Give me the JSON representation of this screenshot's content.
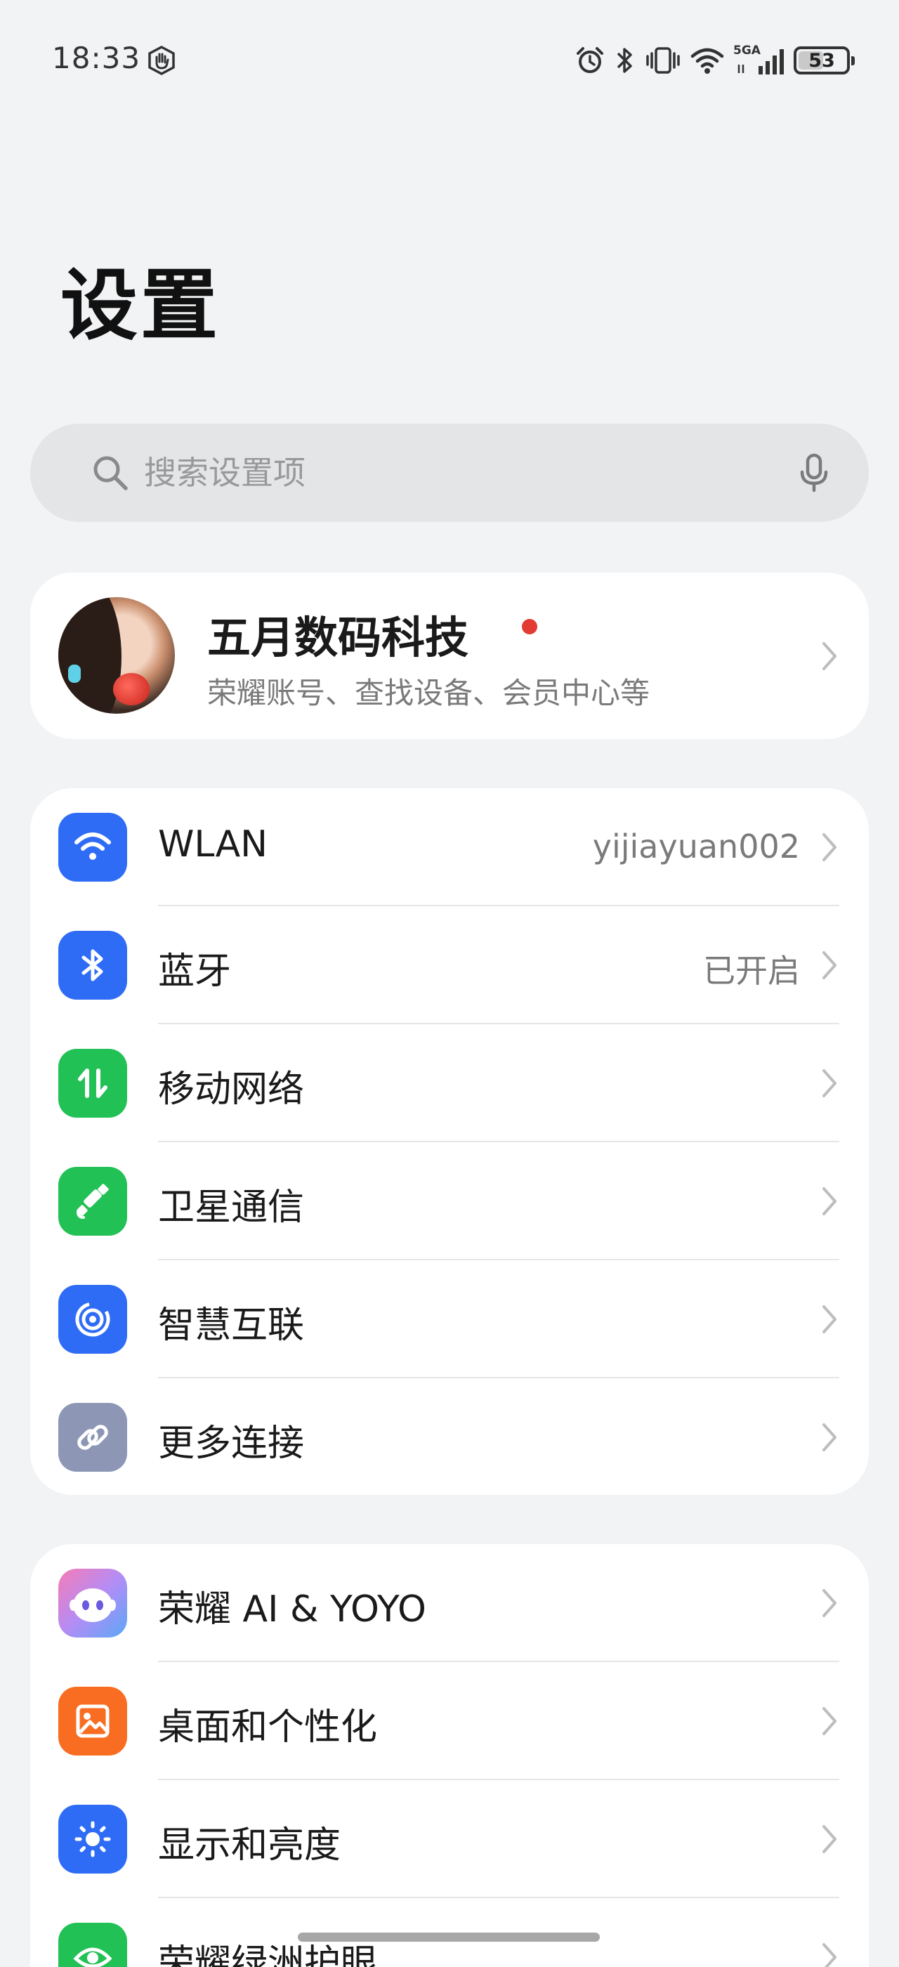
{
  "status_bar": {
    "time": "18:33",
    "icons": [
      "gesture-hand-icon",
      "alarm-icon",
      "bluetooth-icon",
      "vibrate-icon",
      "wifi-icon",
      "5ga-signal-icon",
      "battery-icon"
    ],
    "network_label": "5GA",
    "battery_level": 53,
    "battery_text": "53"
  },
  "page": {
    "title": "设置"
  },
  "search": {
    "placeholder": "搜索设置项",
    "value": ""
  },
  "account": {
    "name": "五月数码科技",
    "subtitle": "荣耀账号、查找设备、会员中心等",
    "has_notification_dot": true
  },
  "connections": [
    {
      "label": "WLAN",
      "value": "yijiayuan002",
      "icon": "wifi-icon",
      "color": "#2f6cf6"
    },
    {
      "label": "蓝牙",
      "value": "已开启",
      "icon": "bluetooth-icon",
      "color": "#2f6cf6"
    },
    {
      "label": "移动网络",
      "value": "",
      "icon": "mobile-data-icon",
      "color": "#22c155"
    },
    {
      "label": "卫星通信",
      "value": "",
      "icon": "satellite-icon",
      "color": "#22c155"
    },
    {
      "label": "智慧互联",
      "value": "",
      "icon": "smart-connect-icon",
      "color": "#2f6cf6"
    },
    {
      "label": "更多连接",
      "value": "",
      "icon": "link-icon",
      "color": "#8d97b5"
    }
  ],
  "display": [
    {
      "label": "荣耀 AI & YOYO",
      "icon": "yoyo-assistant-icon",
      "color": "#c58cf2"
    },
    {
      "label": "桌面和个性化",
      "icon": "image-icon",
      "color": "#f96d22"
    },
    {
      "label": "显示和亮度",
      "icon": "brightness-icon",
      "color": "#2f6cf6"
    },
    {
      "label": "荣耀绿洲护眼",
      "icon": "eye-comfort-icon",
      "color": "#22c155"
    }
  ],
  "colors": {
    "background": "#f1f3f5",
    "card": "#ffffff",
    "accent_blue": "#2f6cf6",
    "accent_green": "#22c155",
    "notification_red": "#e23b33"
  }
}
